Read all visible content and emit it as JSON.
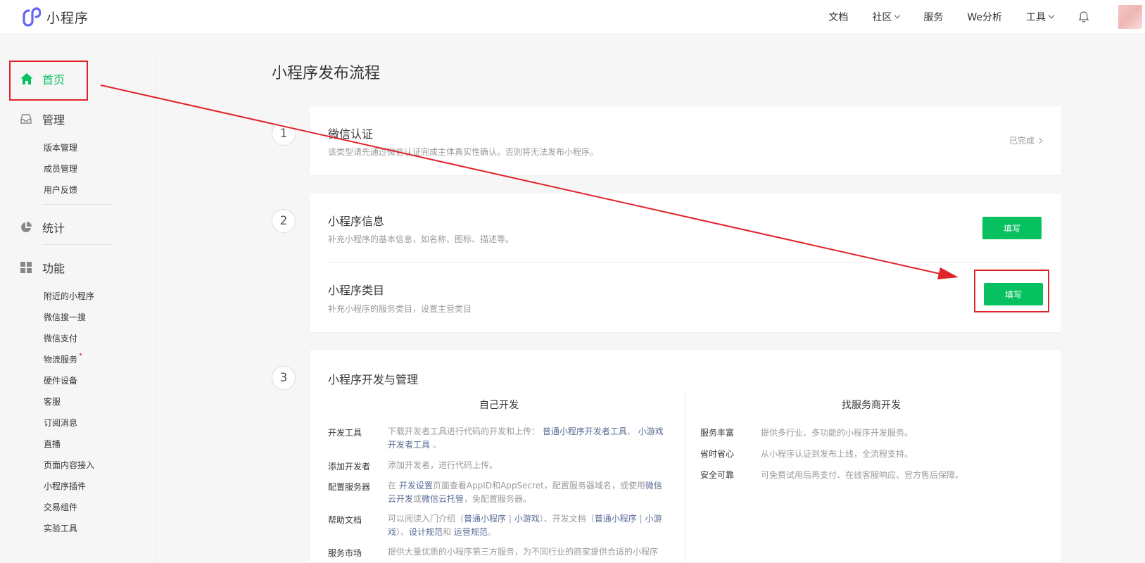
{
  "header": {
    "logo_text": "小程序",
    "nav": [
      {
        "label": "文档",
        "dropdown": false
      },
      {
        "label": "社区",
        "dropdown": true
      },
      {
        "label": "服务",
        "dropdown": false
      },
      {
        "label": "We分析",
        "dropdown": false
      },
      {
        "label": "工具",
        "dropdown": true
      }
    ],
    "accent": "#07c160"
  },
  "sidebar": {
    "home": "首页",
    "manage": {
      "label": "管理",
      "items": [
        "版本管理",
        "成员管理",
        "用户反馈"
      ]
    },
    "stats": {
      "label": "统计"
    },
    "features": {
      "label": "功能",
      "items": [
        "附近的小程序",
        "微信搜一搜",
        "微信支付",
        "物流服务",
        "硬件设备",
        "客服",
        "订阅消息",
        "直播",
        "页面内容接入",
        "小程序插件",
        "交易组件",
        "实验工具"
      ]
    }
  },
  "main": {
    "title": "小程序发布流程",
    "step1": {
      "num": "1",
      "title": "微信认证",
      "desc": "该类型请先通过微信认证完成主体真实性确认。否则将无法发布小程序。",
      "status": "已完成"
    },
    "step2": {
      "num": "2",
      "info_title": "小程序信息",
      "info_desc": "补充小程序的基本信息，如名称、图标、描述等。",
      "info_button": "填写",
      "cat_title": "小程序类目",
      "cat_desc": "补充小程序的服务类目，设置主营类目",
      "cat_button": "填写"
    },
    "step3": {
      "num": "3",
      "title": "小程序开发与管理",
      "self_dev": "自己开发",
      "provider_dev": "找服务商开发",
      "rows": {
        "tools": {
          "label": "开发工具",
          "t1": "下载开发者工具进行代码的开发和上传：",
          "l1": "普通小程序开发者工具",
          "t2": "、",
          "l2": "小游戏开发者工具",
          "t3": "。"
        },
        "add_dev": {
          "label": "添加开发者",
          "t1": "添加开发者，进行代码上传。"
        },
        "server": {
          "label": "配置服务器",
          "t1": "在",
          "l1": "开发设置",
          "t2": "页面查看AppID和AppSecret，配置服务器域名，或使用",
          "l2": "微信云开发",
          "t3": "或",
          "l3": "微信云托管",
          "t4": "，免配置服务器。"
        },
        "help": {
          "label": "帮助文档",
          "t1": "可以阅读入门介绍（",
          "l1": "普通小程序",
          "t2": "|",
          "l2": "小游戏",
          "t3": "）、开发文档（",
          "l3": "普通小程序",
          "t4": "|",
          "l4": "小游戏",
          "t5": "）、",
          "l5": "设计规范",
          "t6": "和",
          "l6": "运营规范",
          "t7": "。"
        },
        "market": {
          "label": "服务市场",
          "t1": "提供大量优质的小程序第三方服务，为不同行业的商家提供合适的小程序"
        }
      },
      "provider_rows": [
        {
          "label": "服务丰富",
          "text": "提供多行业、多功能的小程序开发服务。"
        },
        {
          "label": "省时省心",
          "text": "从小程序认证到发布上线，全流程支持。"
        },
        {
          "label": "安全可靠",
          "text": "可免费试用后再支付、在线客服响应、官方售后保障。"
        }
      ]
    }
  },
  "annotation_color": "#e0242a"
}
